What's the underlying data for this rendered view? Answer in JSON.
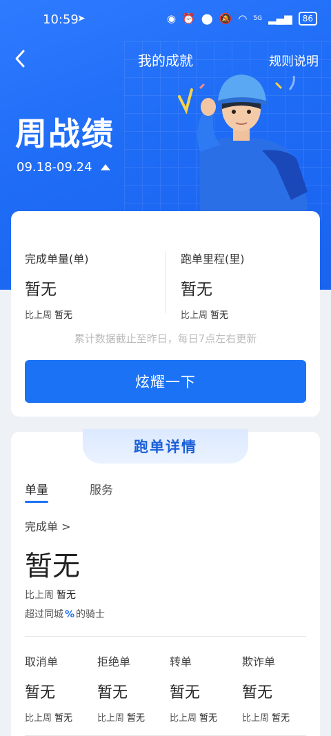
{
  "status_bar": {
    "time": "10:59",
    "battery": "86",
    "network": "5G"
  },
  "nav": {
    "title": "我的成就",
    "rules_label": "规则说明",
    "back_icon": "chevron-left-icon"
  },
  "hero": {
    "title": "周战绩",
    "date_range": "09.18-09.24"
  },
  "summary": {
    "left": {
      "label": "完成单量(单)",
      "value": "暂无",
      "compare_prefix": "比上周",
      "compare_value": "暂无"
    },
    "right": {
      "label": "跑单里程(里)",
      "value": "暂无",
      "compare_prefix": "比上周",
      "compare_value": "暂无"
    },
    "note": "累计数据截止至昨日，每日7点左右更新",
    "show_button": "炫耀一下"
  },
  "details": {
    "header": "跑单详情",
    "tabs": [
      {
        "label": "单量",
        "active": true
      },
      {
        "label": "服务",
        "active": false
      }
    ],
    "completed_link": "完成单 >",
    "completed_value": "暂无",
    "compare_prefix": "比上周",
    "compare_value": "暂无",
    "exceed_prefix": "超过同城",
    "exceed_pct": "%",
    "exceed_suffix": "的骑士",
    "metrics": [
      {
        "label": "取消单",
        "value": "暂无",
        "compare_prefix": "比上周",
        "compare_value": "暂无"
      },
      {
        "label": "拒绝单",
        "value": "暂无",
        "compare_prefix": "比上周",
        "compare_value": "暂无"
      },
      {
        "label": "转单",
        "value": "暂无",
        "compare_prefix": "比上周",
        "compare_value": "暂无"
      },
      {
        "label": "欺诈单",
        "value": "暂无",
        "compare_prefix": "比上周",
        "compare_value": "暂无"
      }
    ]
  },
  "colors": {
    "brand_blue": "#1b72f5",
    "hero_blue": "#2f7bff",
    "header_text": "#1b5fd8"
  }
}
